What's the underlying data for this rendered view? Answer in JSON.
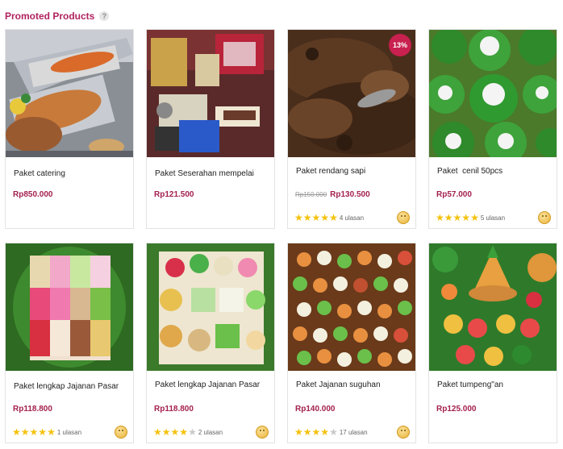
{
  "section": {
    "title": "Promoted Products",
    "help": "?"
  },
  "products": [
    {
      "name": "Paket catering",
      "price": "Rp850.000"
    },
    {
      "name": "Paket Seserahan mempelai",
      "price": "Rp121.500"
    },
    {
      "name": "Paket rendang sapi",
      "old_price": "Rp150.000",
      "price": "Rp130.500",
      "discount": "13%",
      "rating": 5,
      "reviews": "4 ulasan"
    },
    {
      "name": "Paket  cenil 50pcs",
      "price": "Rp57.000",
      "rating": 5,
      "reviews": "5 ulasan"
    },
    {
      "name": "Paket lengkap Jajanan Pasar",
      "price": "Rp118.800",
      "rating": 5,
      "reviews": "1 ulasan"
    },
    {
      "name": "Paket lengkap Jajanan Pasar",
      "price": "Rp118.800",
      "rating": 4,
      "reviews": "2 ulasan"
    },
    {
      "name": "Paket Jajanan suguhan",
      "price": "Rp140.000",
      "rating": 4.5,
      "reviews": "17 ulasan"
    },
    {
      "name": "Paket tumpeng\"an",
      "price": "Rp125.000"
    }
  ],
  "colors": {
    "accent": "#b0235e",
    "price": "#a3204f",
    "badge": "#c8204f",
    "star": "#f5c20c"
  }
}
